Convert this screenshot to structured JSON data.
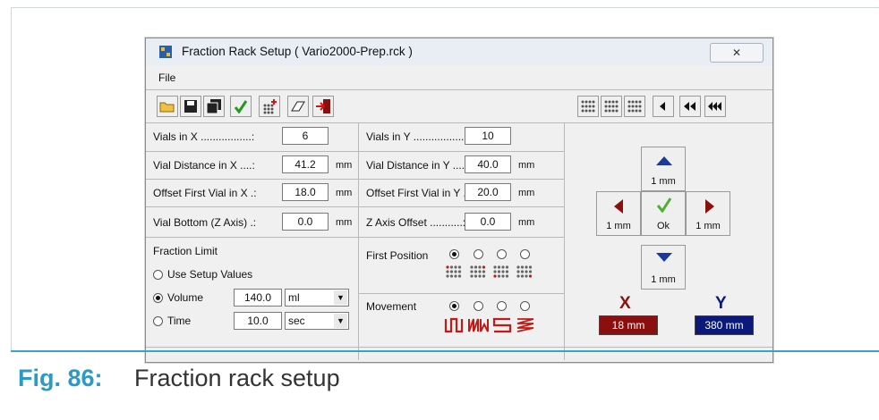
{
  "window": {
    "title": "Fraction Rack Setup ( Vario2000-Prep.rck )",
    "close_label": "✕",
    "menu_file": "File"
  },
  "toolbar": {
    "icons": [
      "open-folder-icon",
      "save-icon",
      "save-all-icon",
      "confirm-check-icon",
      "add-rack-icon",
      "eraser-icon",
      "exit-icon"
    ],
    "right_icons": [
      "rack-grid-1-icon",
      "rack-grid-2-icon",
      "rack-grid-3-icon",
      "step-back-1-icon",
      "step-back-2-icon",
      "step-back-3-icon"
    ]
  },
  "fields": {
    "vials_x_label": "Vials in X .................:",
    "vials_x_value": "6",
    "vials_y_label": "Vials in Y .................:",
    "vials_y_value": "10",
    "dist_x_label": "Vial Distance in X ....:",
    "dist_x_value": "41.2",
    "dist_y_label": "Vial Distance in Y ....:",
    "dist_y_value": "40.0",
    "offset_x_label": "Offset First Vial in X .:",
    "offset_x_value": "18.0",
    "offset_y_label": "Offset First Vial in Y .:",
    "offset_y_value": "20.0",
    "bottom_label": "Vial Bottom (Z Axis) .:",
    "bottom_value": "0.0",
    "zoffset_label": "Z Axis Offset ...........:",
    "zoffset_value": "0.0",
    "unit_mm": "mm"
  },
  "fraction_limit": {
    "title": "Fraction Limit",
    "use_setup_label": "Use Setup Values",
    "volume_label": "Volume",
    "volume_value": "140.0",
    "volume_unit": "ml",
    "time_label": "Time",
    "time_value": "10.0",
    "time_unit": "sec",
    "selected": "Volume"
  },
  "first_position": {
    "label": "First Position",
    "selected_index": 0
  },
  "movement": {
    "label": "Movement",
    "selected_index": 0,
    "glyphs": [
      "ш",
      "ЖМ",
      "⊂",
      "≷"
    ]
  },
  "jog": {
    "step": "1 mm",
    "ok_label": "Ok"
  },
  "axes": {
    "x_label": "X",
    "x_value": "18 mm",
    "x_color": "#8b0f0f",
    "y_label": "Y",
    "y_value": "380 mm",
    "y_color": "#0b1a7a"
  },
  "caption": {
    "number": "Fig. 86:",
    "text": "Fraction rack setup"
  }
}
